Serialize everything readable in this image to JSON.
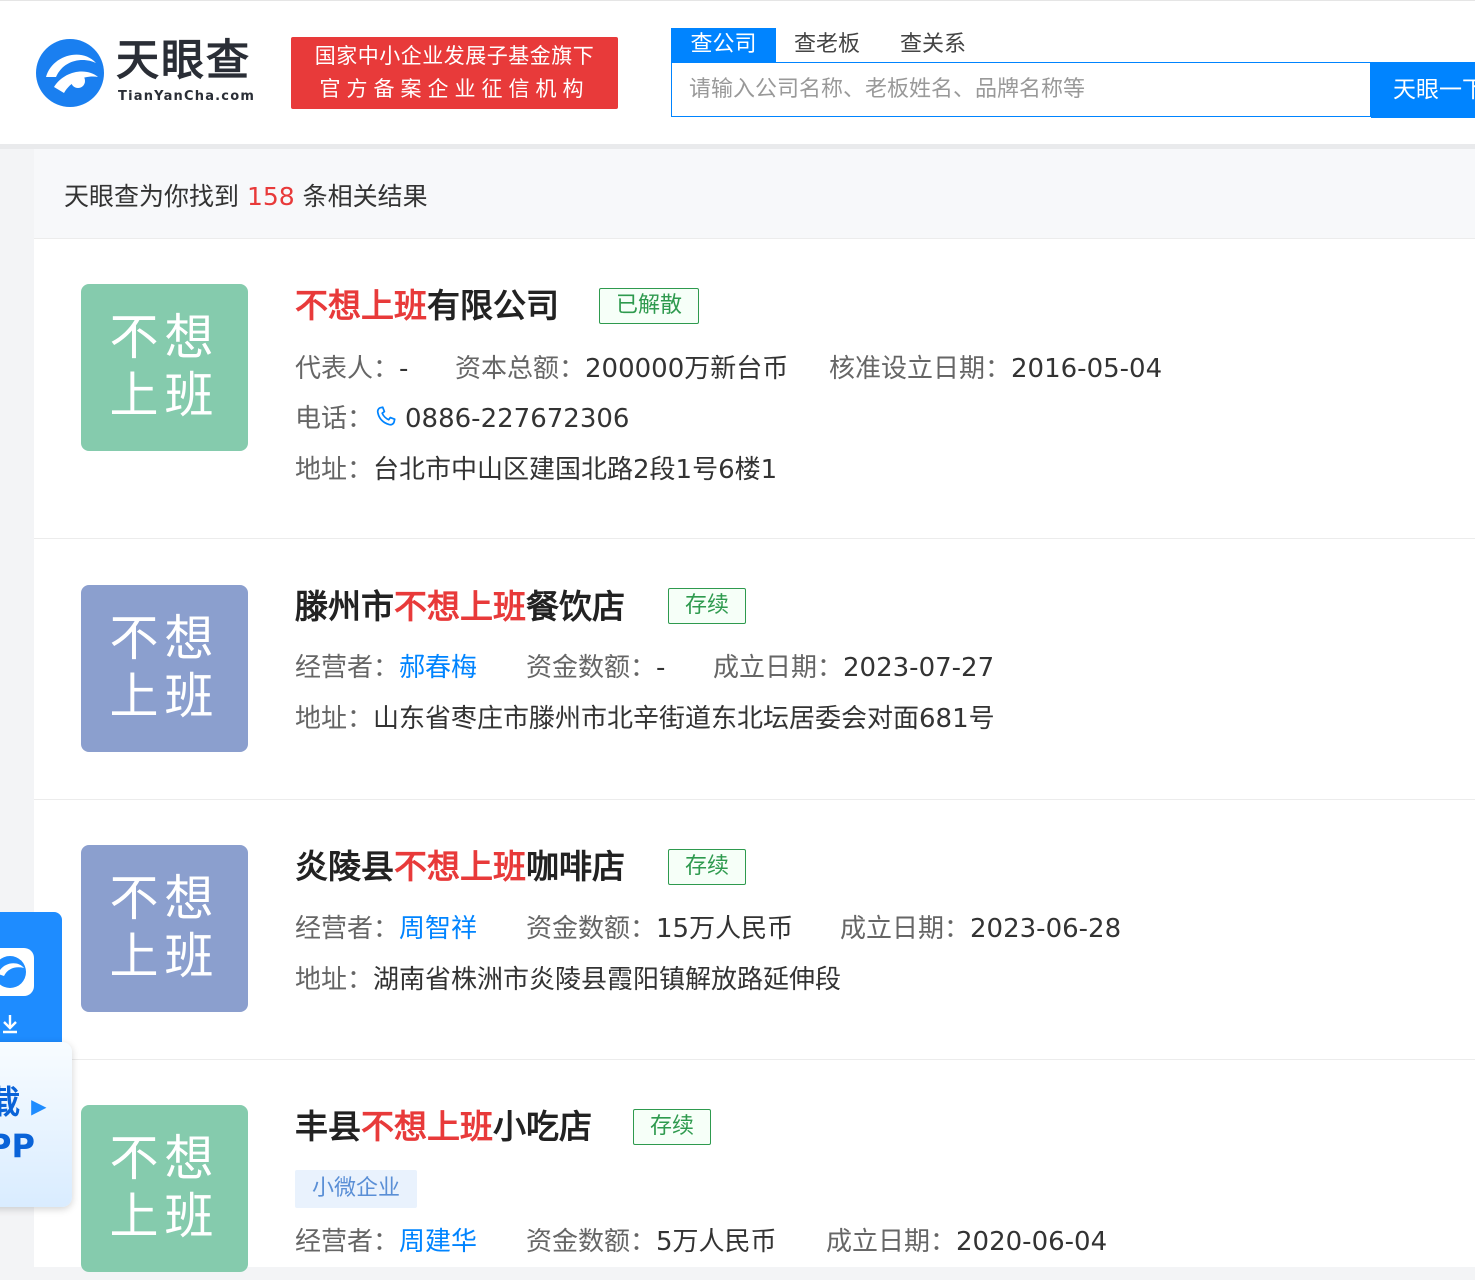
{
  "header": {
    "logo_text": "天眼查",
    "logo_sub": "TianYanCha.com",
    "badge_line1": "国家中小企业发展子基金旗下",
    "badge_line2": "官方备案企业征信机构",
    "tabs": [
      "查公司",
      "查老板",
      "查关系"
    ],
    "search_placeholder": "请输入公司名称、老板姓名、品牌名称等",
    "search_button": "天眼一下"
  },
  "results": {
    "prefix": "天眼查为你找到 ",
    "count": "158",
    "suffix": " 条相关结果"
  },
  "items": [
    {
      "avatar": "不想上班",
      "title_before": "",
      "title_highlight": "不想上班",
      "title_after": "有限公司",
      "status": "已解散",
      "f1_label": "代表人：",
      "f1_value": "-",
      "f2_label": "资本总额：",
      "f2_value": "200000万新台币",
      "f3_label": "核准设立日期：",
      "f3_value": "2016-05-04",
      "phone_label": "电话：",
      "phone": "0886-227672306",
      "addr_label": "地址：",
      "addr": "台北市中山区建国北路2段1号6楼1"
    },
    {
      "avatar": "不想上班",
      "title_before": "滕州市",
      "title_highlight": "不想上班",
      "title_after": "餐饮店",
      "status": "存续",
      "f1_label": "经营者：",
      "f1_value": "郝春梅",
      "f2_label": "资金数额：",
      "f2_value": "-",
      "f3_label": "成立日期：",
      "f3_value": "2023-07-27",
      "addr_label": "地址：",
      "addr": "山东省枣庄市滕州市北辛街道东北坛居委会对面681号"
    },
    {
      "avatar": "不想上班",
      "title_before": "炎陵县",
      "title_highlight": "不想上班",
      "title_after": "咖啡店",
      "status": "存续",
      "f1_label": "经营者：",
      "f1_value": "周智祥",
      "f2_label": "资金数额：",
      "f2_value": "15万人民币",
      "f3_label": "成立日期：",
      "f3_value": "2023-06-28",
      "addr_label": "地址：",
      "addr": "湖南省株洲市炎陵县霞阳镇解放路延伸段"
    },
    {
      "avatar": "不想上班",
      "title_before": "丰县",
      "title_highlight": "不想上班",
      "title_after": "小吃店",
      "status": "存续",
      "tag": "小微企业",
      "f1_label": "经营者：",
      "f1_value": "周建华",
      "f2_label": "资金数额：",
      "f2_value": "5万人民币",
      "f3_label": "成立日期：",
      "f3_value": "2020-06-04"
    }
  ],
  "app_float": {
    "text_line1": "载",
    "text_line2": "PP"
  },
  "colors": {
    "brand_blue": "#0084ff",
    "highlight_red": "#e83a3a",
    "status_green": "#2e9a4e",
    "avatar_green": "#85cbad",
    "avatar_blue": "#8b9fce"
  }
}
